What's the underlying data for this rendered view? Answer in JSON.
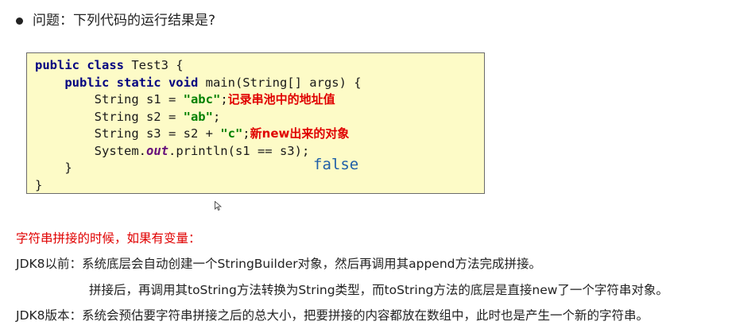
{
  "question": "问题：下列代码的运行结果是?",
  "code": {
    "line1_kw": "public class",
    "line1_rest": " Test3 {",
    "line2_indent": "    ",
    "line2_kw": "public static void",
    "line2_rest": " main(String[] args) {",
    "line3_pre": "        String s1 = ",
    "line3_str": "\"abc\"",
    "line3_post": ";",
    "line3_note": "记录串池中的地址值",
    "line4_pre": "        String s2 = ",
    "line4_str": "\"ab\"",
    "line4_post": ";",
    "line5_pre": "        String s3 = s2 + ",
    "line5_str": "\"c\"",
    "line5_post": ";",
    "line5_note": "新new出来的对象",
    "line6_pre": "        System.",
    "line6_field": "out",
    "line6_post": ".println(s1 == s3);",
    "line7": "    }",
    "line8": "}"
  },
  "result": "false",
  "explain": {
    "heading": "字符串拼接的时候，如果有变量：",
    "line1": "JDK8以前：系统底层会自动创建一个StringBuilder对象，然后再调用其append方法完成拼接。",
    "line2": "拼接后，再调用其toString方法转换为String类型，而toString方法的底层是直接new了一个字符串对象。",
    "line3": "JDK8版本：系统会预估要字符串拼接之后的总大小，把要拼接的内容都放在数组中，此时也是产生一个新的字符串。"
  },
  "colors": {
    "code_bg": "#fdfbc7",
    "keyword": "#000080",
    "string": "#008000",
    "note_red": "#e00000",
    "result_blue": "#1f5fa8"
  }
}
